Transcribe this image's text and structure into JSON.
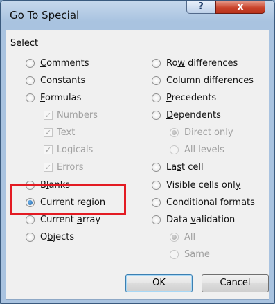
{
  "window": {
    "title": "Go To Special",
    "help_label": "?",
    "close_label": "x"
  },
  "group": {
    "label": "Select"
  },
  "left_options": [
    {
      "pre": "",
      "key": "C",
      "post": "omments",
      "checked": false,
      "disabled": false
    },
    {
      "pre": "C",
      "key": "o",
      "post": "nstants",
      "checked": false,
      "disabled": false
    },
    {
      "pre": "",
      "key": "F",
      "post": "ormulas",
      "checked": false,
      "disabled": false
    },
    {
      "pre": "B",
      "key": "l",
      "post": "anks",
      "checked": false,
      "disabled": false
    },
    {
      "pre": "Current ",
      "key": "r",
      "post": "egion",
      "checked": true,
      "disabled": false
    },
    {
      "pre": "Current ",
      "key": "a",
      "post": "rray",
      "checked": false,
      "disabled": false
    },
    {
      "pre": "O",
      "key": "b",
      "post": "jects",
      "checked": false,
      "disabled": false
    }
  ],
  "formula_checks": [
    {
      "label": "Numbers",
      "checked": true
    },
    {
      "label": "Text",
      "checked": true
    },
    {
      "label": "Logicals",
      "checked": true
    },
    {
      "label": "Errors",
      "checked": true
    }
  ],
  "right_options": [
    {
      "pre": "Ro",
      "key": "w",
      "post": " differences",
      "checked": false,
      "disabled": false
    },
    {
      "pre": "Colu",
      "key": "m",
      "post": "n differences",
      "checked": false,
      "disabled": false
    },
    {
      "pre": "",
      "key": "P",
      "post": "recedents",
      "checked": false,
      "disabled": false
    },
    {
      "pre": "",
      "key": "D",
      "post": "ependents",
      "checked": false,
      "disabled": false
    },
    {
      "pre": "",
      "key": "",
      "post": "Direct only",
      "checked": true,
      "disabled": true
    },
    {
      "pre": "",
      "key": "",
      "post": "All levels",
      "checked": false,
      "disabled": true
    },
    {
      "pre": "La",
      "key": "s",
      "post": "t cell",
      "checked": false,
      "disabled": false
    },
    {
      "pre": "Visible cells onl",
      "key": "y",
      "post": "",
      "checked": false,
      "disabled": false
    },
    {
      "pre": "Condi",
      "key": "t",
      "post": "ional formats",
      "checked": false,
      "disabled": false
    },
    {
      "pre": "Data ",
      "key": "v",
      "post": "alidation",
      "checked": false,
      "disabled": false
    },
    {
      "pre": "",
      "key": "",
      "post": "All",
      "checked": true,
      "disabled": true
    },
    {
      "pre": "",
      "key": "",
      "post": "Same",
      "checked": false,
      "disabled": true
    }
  ],
  "buttons": {
    "ok_label": "OK",
    "cancel_label": "Cancel"
  }
}
